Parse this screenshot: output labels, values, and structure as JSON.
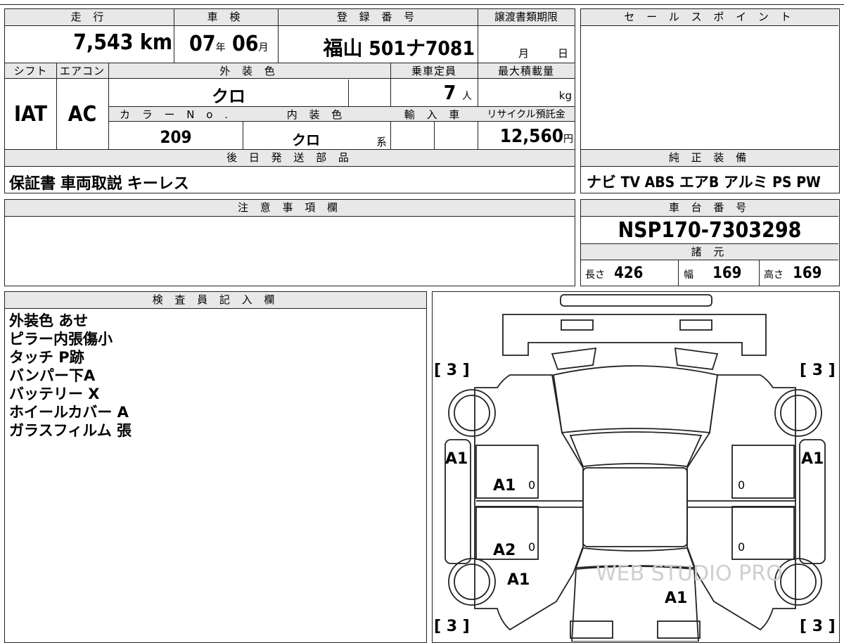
{
  "top": {
    "mileage_label": "走 行",
    "mileage_value": "7,543",
    "mileage_unit": "km",
    "inspection_label": "車 検",
    "insp_year": "07",
    "insp_year_unit": "年",
    "insp_month": "06",
    "insp_month_unit": "月",
    "reg_label": "登 録 番 号",
    "reg_value": "福山 501ナ7081",
    "transfer_label": "譲渡書類期限",
    "transfer_month": "月",
    "transfer_day": "日",
    "sales_label": "セ ー ル ス ポ イ ン ト"
  },
  "spec": {
    "shift_label": "シフト",
    "shift_value": "IAT",
    "ac_label": "エアコン",
    "ac_value": "AC",
    "ext_color_label": "外 装 色",
    "ext_color_value": "クロ",
    "capacity_label": "乗車定員",
    "capacity_value": "7",
    "capacity_unit": "人",
    "maxload_label": "最大積載量",
    "maxload_unit": "kg",
    "color_no_label": "カ ラ ー N o .",
    "color_no_value": "209",
    "int_color_label": "内 装 色",
    "int_color_value": "クロ",
    "int_color_unit": "系",
    "import_label": "輸 入 車",
    "recycle_label": "リサイクル預託金",
    "recycle_value": "12,560",
    "recycle_unit": "円"
  },
  "later_parts": {
    "label": "後 日 発 送 部 品",
    "value": "保証書 車両取説 キーレス"
  },
  "genuine_equipment": {
    "label": "純 正 装 備",
    "value": "ナビ TV ABS エアB アルミ PS PW"
  },
  "caution": {
    "label": "注 意 事 項 欄"
  },
  "chassis": {
    "label": "車 台 番 号",
    "value": "NSP170-7303298",
    "dims_label": "諸 元",
    "length_label": "長さ",
    "length_value": "426",
    "width_label": "幅",
    "width_value": "169",
    "height_label": "高さ",
    "height_value": "169"
  },
  "inspector": {
    "label": "検 査 員 記 入 欄",
    "notes": [
      "外装色 あせ",
      "ピラー内張傷小",
      "タッチ P跡",
      "バンパー下A",
      "バッテリー X",
      "ホイールカバー A",
      "ガラスフィルム 張"
    ]
  },
  "diagram": {
    "tire_fl": "[ 3 ]",
    "tire_fr": "[ 3 ]",
    "tire_rl": "[ 3 ]",
    "tire_rr": "[ 3 ]",
    "left_side": "A1",
    "right_side": "A1",
    "left_front_door": "A1",
    "left_rear_door": "A2",
    "left_rear_panel": "A1",
    "rear_area": "A1",
    "door_zero": "0",
    "watermark": "WEB STUDIO PRO"
  }
}
